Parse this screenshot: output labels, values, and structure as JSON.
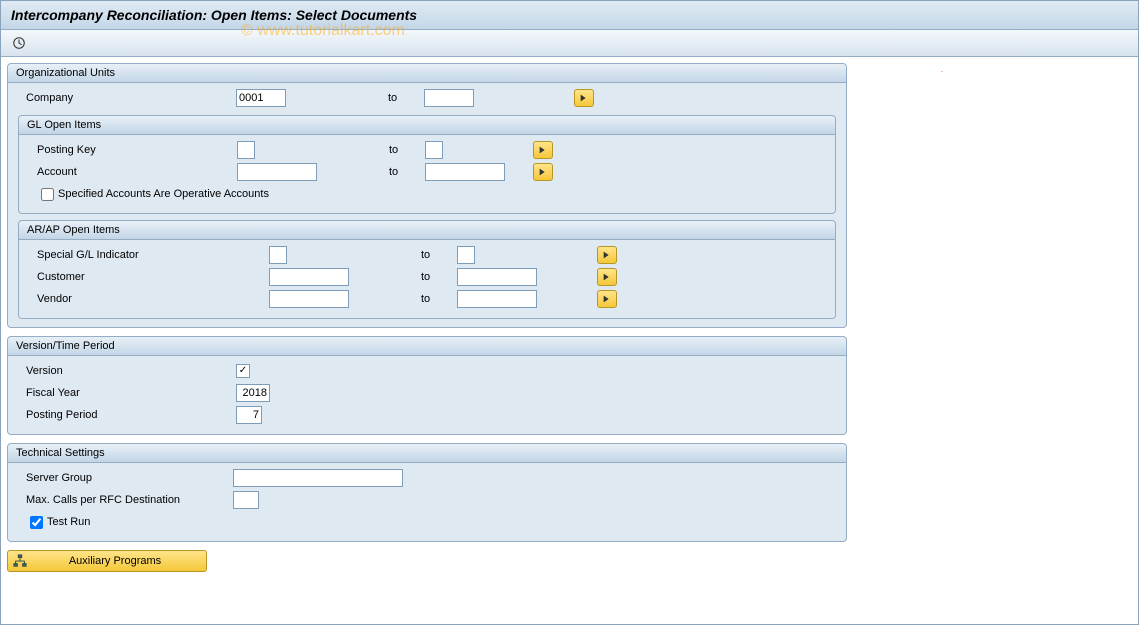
{
  "header": {
    "title": "Intercompany Reconciliation: Open Items: Select Documents"
  },
  "watermark": "© www.tutorialkart.com",
  "groups": {
    "org": {
      "title": "Organizational Units",
      "company_label": "Company",
      "company_value": "0001",
      "to": "to",
      "company_to": "",
      "gl": {
        "title": "GL Open Items",
        "posting_key_label": "Posting Key",
        "posting_key_value": "",
        "posting_key_to": "",
        "account_label": "Account",
        "account_value": "",
        "account_to": "",
        "specified_label": "Specified Accounts Are Operative Accounts",
        "specified_checked": false
      },
      "arap": {
        "title": "AR/AP Open Items",
        "special_gl_label": "Special G/L Indicator",
        "special_gl_value": "",
        "special_gl_to": "",
        "customer_label": "Customer",
        "customer_value": "",
        "customer_to": "",
        "vendor_label": "Vendor",
        "vendor_value": "",
        "vendor_to": ""
      }
    },
    "version": {
      "title": "Version/Time Period",
      "version_label": "Version",
      "version_checked": true,
      "fiscal_year_label": "Fiscal Year",
      "fiscal_year_value": "2018",
      "posting_period_label": "Posting Period",
      "posting_period_value": "7"
    },
    "tech": {
      "title": "Technical Settings",
      "server_group_label": "Server Group",
      "server_group_value": "",
      "max_calls_label": "Max. Calls per RFC Destination",
      "max_calls_value": "",
      "test_run_label": "Test Run",
      "test_run_checked": true
    }
  },
  "buttons": {
    "aux_programs": "Auxiliary Programs"
  }
}
